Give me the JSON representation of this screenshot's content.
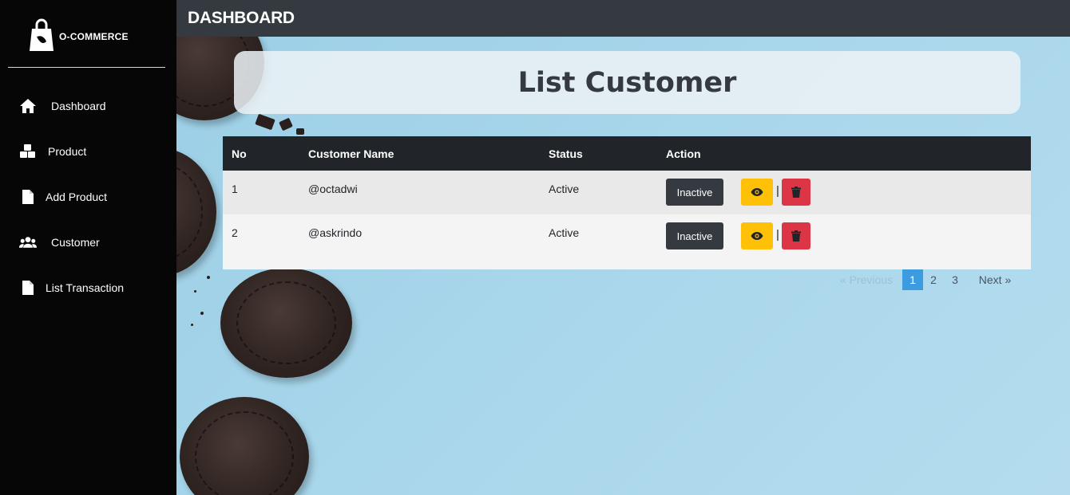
{
  "brand": {
    "name": "O-COMMERCE"
  },
  "sidebar": {
    "items": [
      {
        "label": "Dashboard",
        "icon": "home-icon"
      },
      {
        "label": "Product",
        "icon": "cubes-icon"
      },
      {
        "label": "Add Product",
        "icon": "file-icon"
      },
      {
        "label": "Customer",
        "icon": "users-icon"
      },
      {
        "label": "List Transaction",
        "icon": "file-icon"
      }
    ]
  },
  "topbar": {
    "title": "DASHBOARD"
  },
  "page": {
    "title": "List Customer"
  },
  "table": {
    "headers": [
      "No",
      "Customer Name",
      "Status",
      "Action"
    ],
    "rows": [
      {
        "no": "1",
        "name": "@octadwi",
        "status": "Active",
        "action_label": "Inactive"
      },
      {
        "no": "2",
        "name": "@askrindo",
        "status": "Active",
        "action_label": "Inactive"
      }
    ],
    "separator": "|"
  },
  "pagination": {
    "prev": "« Previous",
    "pages": [
      "1",
      "2",
      "3"
    ],
    "current": "1",
    "next": "Next  »"
  },
  "colors": {
    "sidebar_bg": "#060606",
    "topbar_bg": "#343a40",
    "table_header_bg": "#212529",
    "view_button": "#ffc107",
    "delete_button": "#dc3545",
    "inactive_button": "#343a40",
    "active_page": "#3d9be0"
  }
}
